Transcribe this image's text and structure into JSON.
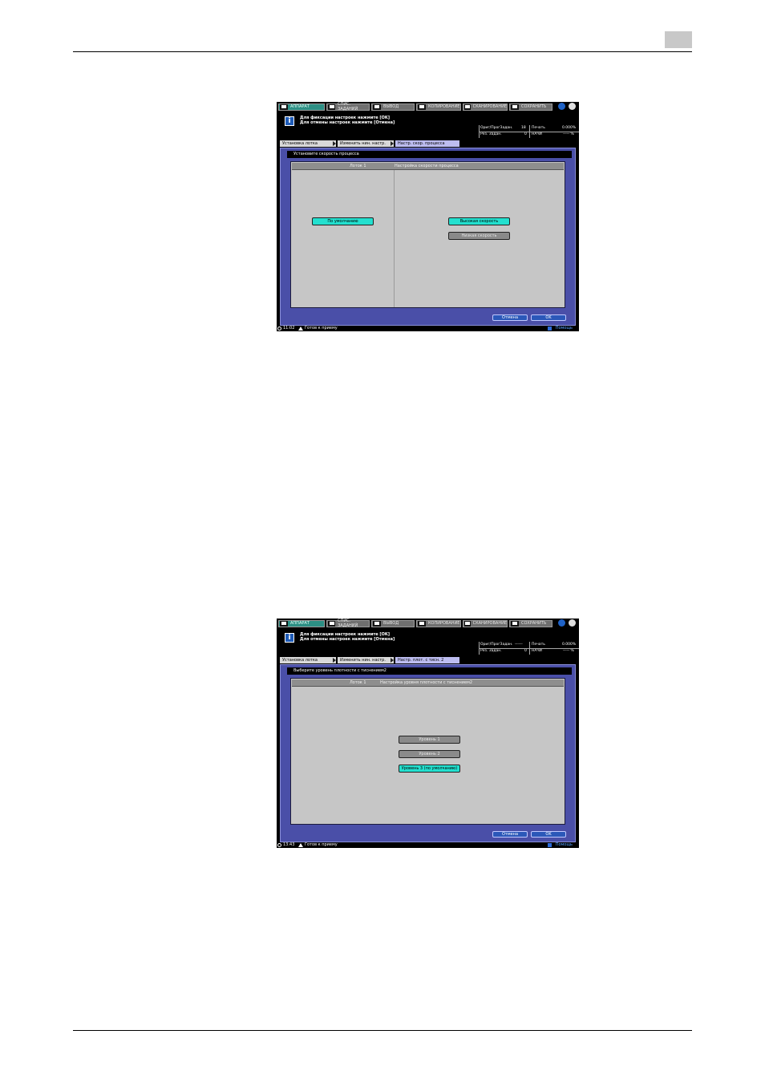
{
  "screen1": {
    "tabs": [
      "АППАРАТ",
      "СПИС. ЗАДАНИЙ",
      "ВЫВОД",
      "КОПИРОВАНИЕ",
      "СКАНИРОВАНИЕ",
      "СОХРАНИТЬ"
    ],
    "message": [
      "Для фиксации настроек нажмите [OK]",
      "Для отмены настроек нажмите [Отмена]"
    ],
    "info": {
      "orig_label": "Ориг/ПрогЗадан.",
      "orig_value": "18",
      "print_label": "Печать",
      "print_value": "0.000%",
      "res_label": "Рез. Задан.",
      "res_value": "0",
      "ink_label": "НАЧИ",
      "ink_value": "----- %"
    },
    "breadcrumb": [
      "Установка лотка",
      "Изменить нин. настр.",
      "Настр. скор. процесса"
    ],
    "instruction": "Установите скорость процесса",
    "header_left": "Лоток 1",
    "header_right": "Настройка скорости процесса",
    "buttons": {
      "default": "По умолчанию",
      "high": "Высокая скорость",
      "low": "Низкая скорость"
    },
    "cancel": "Отмена",
    "ok": "OK",
    "time": "11:02",
    "status": "Готов к приему",
    "help": "Помощь"
  },
  "screen2": {
    "tabs": [
      "АППАРАТ",
      "СПИС. ЗАДАНИЙ",
      "ВЫВОД",
      "КОПИРОВАНИЕ",
      "СКАНИРОВАНИЕ",
      "СОХРАНИТЬ"
    ],
    "message": [
      "Для фиксации настроек нажмите [OK]",
      "Для отмены настроек нажмите [Отмена]"
    ],
    "info": {
      "orig_label": "Ориг/ПрогЗадан.",
      "orig_value": "------",
      "print_label": "Печать",
      "print_value": "0.000%",
      "res_label": "Рез. Задан.",
      "res_value": "0",
      "ink_label": "НАЧИ",
      "ink_value": "----- %"
    },
    "breadcrumb": [
      "Установка лотка",
      "Изменить нин. настр.",
      "Настр. плот. с тисн. 2"
    ],
    "instruction": "Выберите уровень плотности с тиснением2",
    "header_left": "Лоток 1",
    "header_right": "Настройка уровня плотности с тиснением2",
    "buttons": {
      "level1": "Уровень 1",
      "level2": "Уровень 2",
      "level3": "Уровень 3 (по умолчанию)"
    },
    "cancel": "Отмена",
    "ok": "OK",
    "time": "13:43",
    "status": "Готов к приему",
    "help": "Помощь"
  }
}
